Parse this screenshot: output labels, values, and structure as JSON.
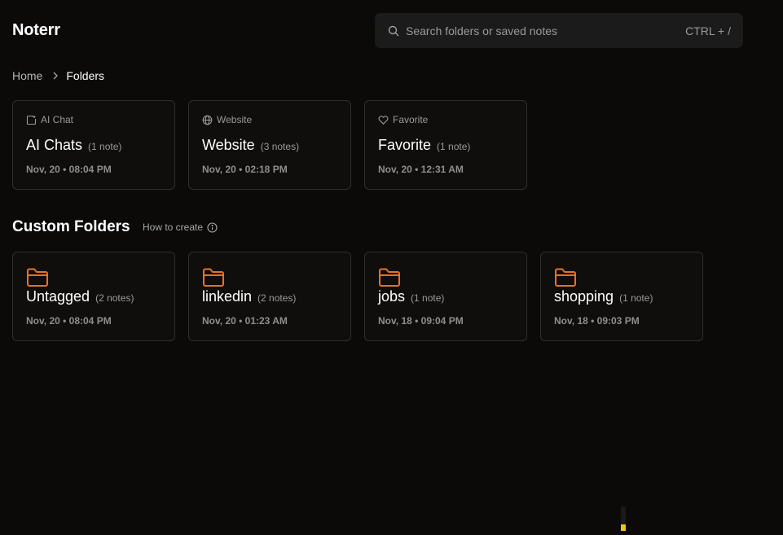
{
  "app": {
    "title": "Noterr"
  },
  "search": {
    "placeholder": "Search folders or saved notes",
    "shortcut": "CTRL + /",
    "icon": "search-icon"
  },
  "breadcrumb": {
    "home": "Home",
    "current": "Folders"
  },
  "system_folders": [
    {
      "kind": "AI Chat",
      "icon": "chat-icon",
      "name": "AI Chats",
      "count": "(1 note)",
      "date": "Nov, 20 • 08:04 PM"
    },
    {
      "kind": "Website",
      "icon": "globe-icon",
      "name": "Website",
      "count": "(3 notes)",
      "date": "Nov, 20 • 02:18 PM"
    },
    {
      "kind": "Favorite",
      "icon": "heart-icon",
      "name": "Favorite",
      "count": "(1 note)",
      "date": "Nov, 20 • 12:31 AM"
    }
  ],
  "custom_section": {
    "title": "Custom Folders",
    "how_to": "How to create"
  },
  "custom_folders": [
    {
      "name": "Untagged",
      "count": "(2 notes)",
      "date": "Nov, 20 • 08:04 PM"
    },
    {
      "name": "linkedin",
      "count": "(2 notes)",
      "date": "Nov, 20 • 01:23 AM"
    },
    {
      "name": "jobs",
      "count": "(1 note)",
      "date": "Nov, 18 • 09:04 PM"
    },
    {
      "name": "shopping",
      "count": "(1 note)",
      "date": "Nov, 18 • 09:03 PM"
    }
  ],
  "colors": {
    "accent": "#e8731f",
    "background": "#0b0a09",
    "card_border": "#2f2e2c"
  }
}
